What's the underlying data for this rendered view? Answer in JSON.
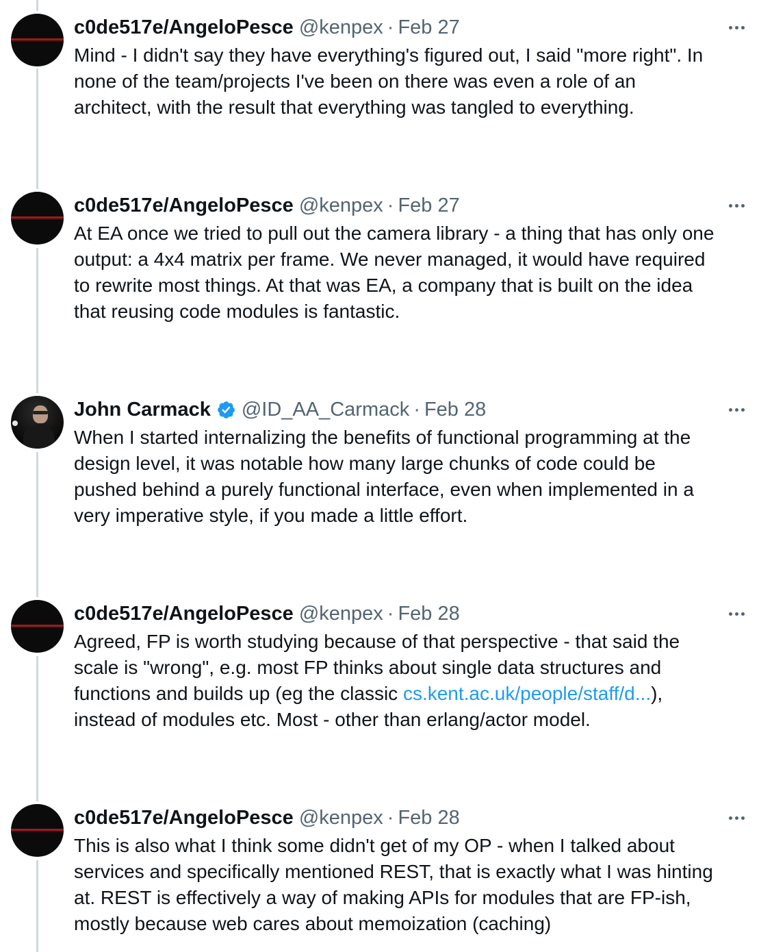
{
  "tweets": [
    {
      "name": "c0de517e/AngeloPesce",
      "handle": "@kenpex",
      "separator": "·",
      "date": "Feb 27",
      "lines": [
        "Mind - I didn't say they have everything's figured out, I said \"more right\". In",
        "none of the team/projects I've been on there was even a role of an",
        "architect, with the result that everything was tangled to everything."
      ]
    },
    {
      "name": "c0de517e/AngeloPesce",
      "handle": "@kenpex",
      "separator": "·",
      "date": "Feb 27",
      "lines": [
        "At EA once we tried to pull out the camera library - a thing that has only one",
        "output: a 4x4 matrix per frame. We never managed, it would have required",
        "to rewrite most things. At that was EA, a company that is built on the idea",
        "that reusing code modules is fantastic."
      ]
    },
    {
      "name": "John Carmack",
      "handle": "@ID_AA_Carmack",
      "separator": "·",
      "date": "Feb 28",
      "verified": true,
      "lines": [
        "When I started internalizing the benefits of functional programming at the",
        "design level, it was notable how many large chunks of code could be",
        "pushed behind a purely functional interface, even when implemented in a",
        "very imperative style, if you made a little effort."
      ]
    },
    {
      "name": "c0de517e/AngeloPesce",
      "handle": "@kenpex",
      "separator": "·",
      "date": "Feb 28",
      "lines": [
        "Agreed, FP is worth studying because of that perspective - that said the",
        "scale is \"wrong\", e.g. most FP thinks about single data structures and"
      ],
      "link_line": {
        "before": "functions and builds up (eg the classic ",
        "link": "cs.kent.ac.uk/people/staff/d...",
        "after": "),"
      },
      "lines_after": [
        "instead of modules etc. Most - other than erlang/actor model."
      ]
    },
    {
      "name": "c0de517e/AngeloPesce",
      "handle": "@kenpex",
      "separator": "·",
      "date": "Feb 28",
      "lines": [
        "This is also what I think some didn't get of my OP - when I talked about",
        "services and specifically mentioned REST, that is exactly what I was hinting",
        "at. REST is effectively a way of making APIs for modules that are FP-ish,",
        "mostly because web cares about memoization (caching)"
      ]
    }
  ],
  "colors": {
    "text": "#0f1419",
    "muted": "#536471",
    "link": "#1d9bf0",
    "verified": "#1d9bf0",
    "thread_line": "#cfd9de"
  }
}
